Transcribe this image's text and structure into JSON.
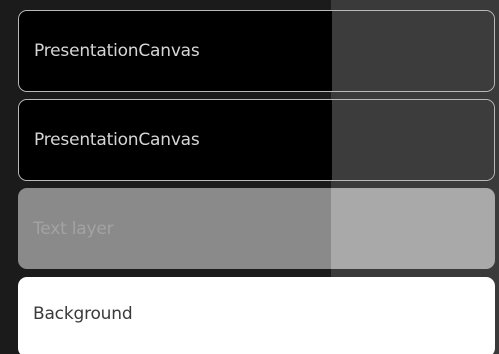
{
  "layers": {
    "items": [
      {
        "label": "PresentationCanvas"
      },
      {
        "label": "PresentationCanvas"
      },
      {
        "label": "Text layer"
      },
      {
        "label": "Background"
      }
    ]
  }
}
